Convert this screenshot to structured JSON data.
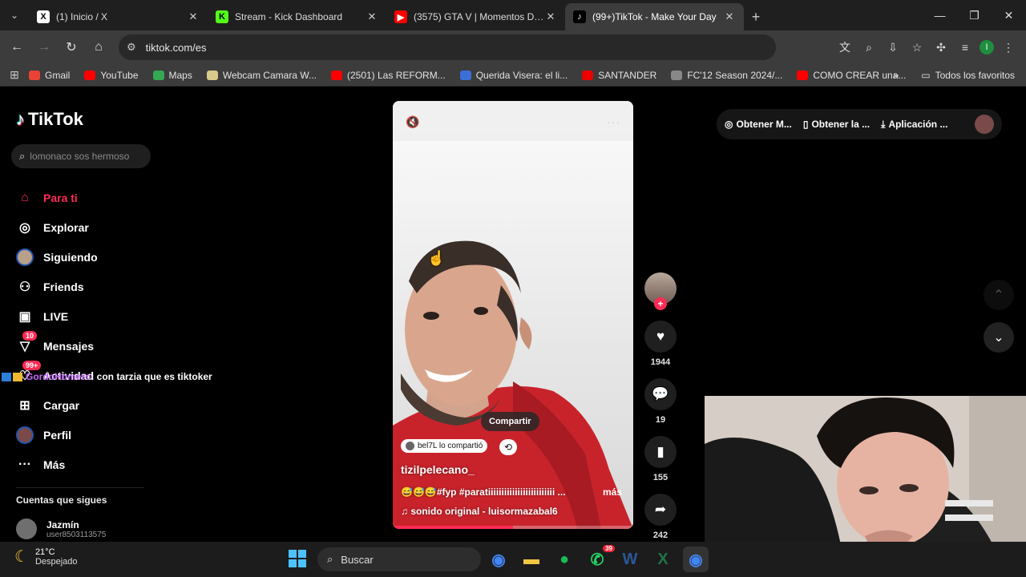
{
  "browser": {
    "tabs": [
      {
        "title": "(1) Inicio / X",
        "icon": "x-icon",
        "icon_glyph": "X",
        "icon_color": "#000000",
        "icon_bg": "#ffffff"
      },
      {
        "title": "Stream - Kick Dashboard",
        "icon": "kick-icon",
        "icon_glyph": "K",
        "icon_color": "#000000",
        "icon_bg": "#53fc18"
      },
      {
        "title": "(3575) GTA V | Momentos Diver",
        "icon": "youtube-icon",
        "icon_glyph": "▶",
        "icon_color": "#ffffff",
        "icon_bg": "#ff0000"
      },
      {
        "title": "(99+)TikTok - Make Your Day",
        "icon": "tiktok-icon",
        "icon_glyph": "♪",
        "icon_color": "#ffffff",
        "icon_bg": "#000000",
        "active": true
      }
    ],
    "address": "tiktok.com/es",
    "profile_initial": "I",
    "bookmarks": [
      {
        "label": "Gmail",
        "icon": "gmail-icon",
        "color": "#ea4335"
      },
      {
        "label": "YouTube",
        "icon": "youtube-icon",
        "color": "#ff0000"
      },
      {
        "label": "Maps",
        "icon": "maps-icon",
        "color": "#34a853"
      },
      {
        "label": "Webcam Camara W...",
        "icon": "webcam-icon",
        "color": "#d9c98a"
      },
      {
        "label": "(2501) Las REFORM...",
        "icon": "youtube-icon",
        "color": "#ff0000"
      },
      {
        "label": "Querida Visera: el li...",
        "icon": "site-icon",
        "color": "#3b6fd8"
      },
      {
        "label": "SANTANDER",
        "icon": "santander-icon",
        "color": "#ec0000"
      },
      {
        "label": "FC'12 Season 2024/...",
        "icon": "fc-icon",
        "color": "#888888"
      },
      {
        "label": "COMO CREAR una...",
        "icon": "youtube-icon",
        "color": "#ff0000"
      }
    ],
    "all_bookmarks": "Todos los favoritos"
  },
  "tiktok": {
    "brand": "TikTok",
    "search_placeholder": "lomonaco sos hermoso",
    "nav": [
      {
        "label": "Para ti",
        "icon": "home-icon",
        "glyph": "⌂",
        "active": true
      },
      {
        "label": "Explorar",
        "icon": "compass-icon",
        "glyph": "◎"
      },
      {
        "label": "Siguiendo",
        "icon": "following-avatar-icon",
        "glyph": "●"
      },
      {
        "label": "Friends",
        "icon": "friends-icon",
        "glyph": "⚇"
      },
      {
        "label": "LIVE",
        "icon": "live-icon",
        "glyph": "▣"
      },
      {
        "label": "Mensajes",
        "icon": "messages-icon",
        "glyph": "▽",
        "badge": "10"
      },
      {
        "label": "Actividad",
        "icon": "activity-icon",
        "glyph": "♡",
        "badge": "99+"
      },
      {
        "label": "Cargar",
        "icon": "upload-icon",
        "glyph": "⊞"
      },
      {
        "label": "Perfil",
        "icon": "profile-icon",
        "glyph": "●"
      },
      {
        "label": "Más",
        "icon": "more-icon",
        "glyph": "···"
      }
    ],
    "chat_overlay": {
      "user": "GordoHomero",
      "message": ": con tarzia que es tiktoker"
    },
    "following_title": "Cuentas que sigues",
    "following_user": {
      "name": "Jazmín",
      "handle": "user8503113575"
    },
    "video": {
      "share_tooltip": "Compartir",
      "repost_text": "bel7L lo compartió",
      "author": "tizilpelecano_",
      "caption": "😅😅😅#fyp #paratiiiiiiiiiiiiiiiiiiiiiiiii ...",
      "more": "más",
      "sound": "sonido original - luisormazabal6",
      "progress": 0.5
    },
    "actions": {
      "likes": "1944",
      "comments": "19",
      "saves": "155",
      "shares": "242"
    },
    "top_menu": [
      "Obtener M...",
      "Obtener la ...",
      "Aplicación ..."
    ]
  },
  "taskbar": {
    "temp": "21°C",
    "weather": "Despejado",
    "search": "Buscar",
    "apps": [
      {
        "name": "chrome-icon",
        "glyph": "◉",
        "color": "#4285f4"
      },
      {
        "name": "explorer-icon",
        "glyph": "▬",
        "color": "#f4c542"
      },
      {
        "name": "spotify-icon",
        "glyph": "●",
        "color": "#1db954"
      },
      {
        "name": "whatsapp-icon",
        "glyph": "✆",
        "color": "#25d366",
        "badge": "39"
      },
      {
        "name": "word-icon",
        "glyph": "W",
        "color": "#2b579a"
      },
      {
        "name": "excel-icon",
        "glyph": "X",
        "color": "#217346"
      },
      {
        "name": "chrome-active-icon",
        "glyph": "◉",
        "color": "#4285f4"
      }
    ]
  }
}
